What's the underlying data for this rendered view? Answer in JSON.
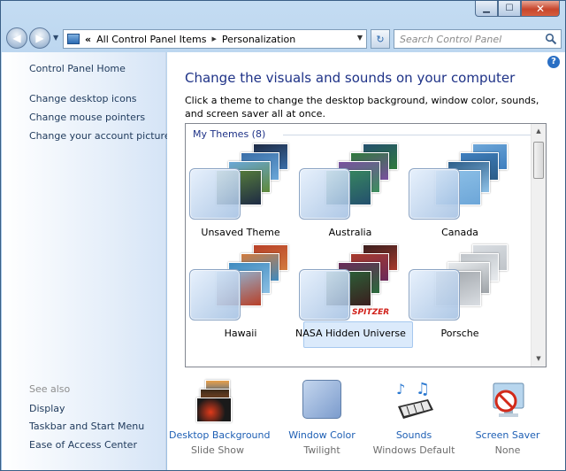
{
  "window": {
    "caption": {
      "minimize": "▁",
      "maximize": "☐",
      "close": "✕"
    }
  },
  "toolbar": {
    "back": "◀",
    "forward": "▶",
    "address": {
      "chevron": "«",
      "crumbs": [
        "All Control Panel Items",
        "Personalization"
      ],
      "separator": "▶"
    },
    "refresh": "↻",
    "search_placeholder": "Search Control Panel"
  },
  "sidebar": {
    "home": "Control Panel Home",
    "links": [
      "Change desktop icons",
      "Change mouse pointers",
      "Change your account picture"
    ],
    "see_also_heading": "See also",
    "see_also": [
      "Display",
      "Taskbar and Start Menu",
      "Ease of Access Center"
    ]
  },
  "content": {
    "help": "?",
    "title": "Change the visuals and sounds on your computer",
    "subtitle": "Click a theme to change the desktop background, window color, sounds, and screen saver all at once.",
    "group_heading": "My Themes (8)",
    "themes": [
      {
        "name": "Unsaved Theme",
        "colors": [
          "#1e2a44",
          "#3a6ea8",
          "#6aa7d8",
          "#5f8a3a"
        ]
      },
      {
        "name": "Australia",
        "colors": [
          "#24506e",
          "#2f7a3c",
          "#7a4fa0",
          "#3b8f5c"
        ]
      },
      {
        "name": "Canada",
        "colors": [
          "#6da6d8",
          "#3f7fbf",
          "#2c5d88",
          "#8fc2e8"
        ]
      },
      {
        "name": "Hawaii",
        "colors": [
          "#b84028",
          "#d27b3e",
          "#3f8abf",
          "#8cc0e4"
        ]
      },
      {
        "name": "NASA Hidden Universe",
        "colors": [
          "#3a1e1e",
          "#a83a2c",
          "#6a2a5a",
          "#2a6a3c"
        ],
        "badge": "SPITZER"
      },
      {
        "name": "Porsche",
        "colors": [
          "#d9dde2",
          "#bfc4c9",
          "#e8ebee",
          "#9ea3a8"
        ]
      }
    ]
  },
  "bottom": {
    "items": [
      {
        "label": "Desktop Background",
        "value": "Slide Show"
      },
      {
        "label": "Window Color",
        "value": "Twilight"
      },
      {
        "label": "Sounds",
        "value": "Windows Default"
      },
      {
        "label": "Screen Saver",
        "value": "None"
      }
    ]
  }
}
